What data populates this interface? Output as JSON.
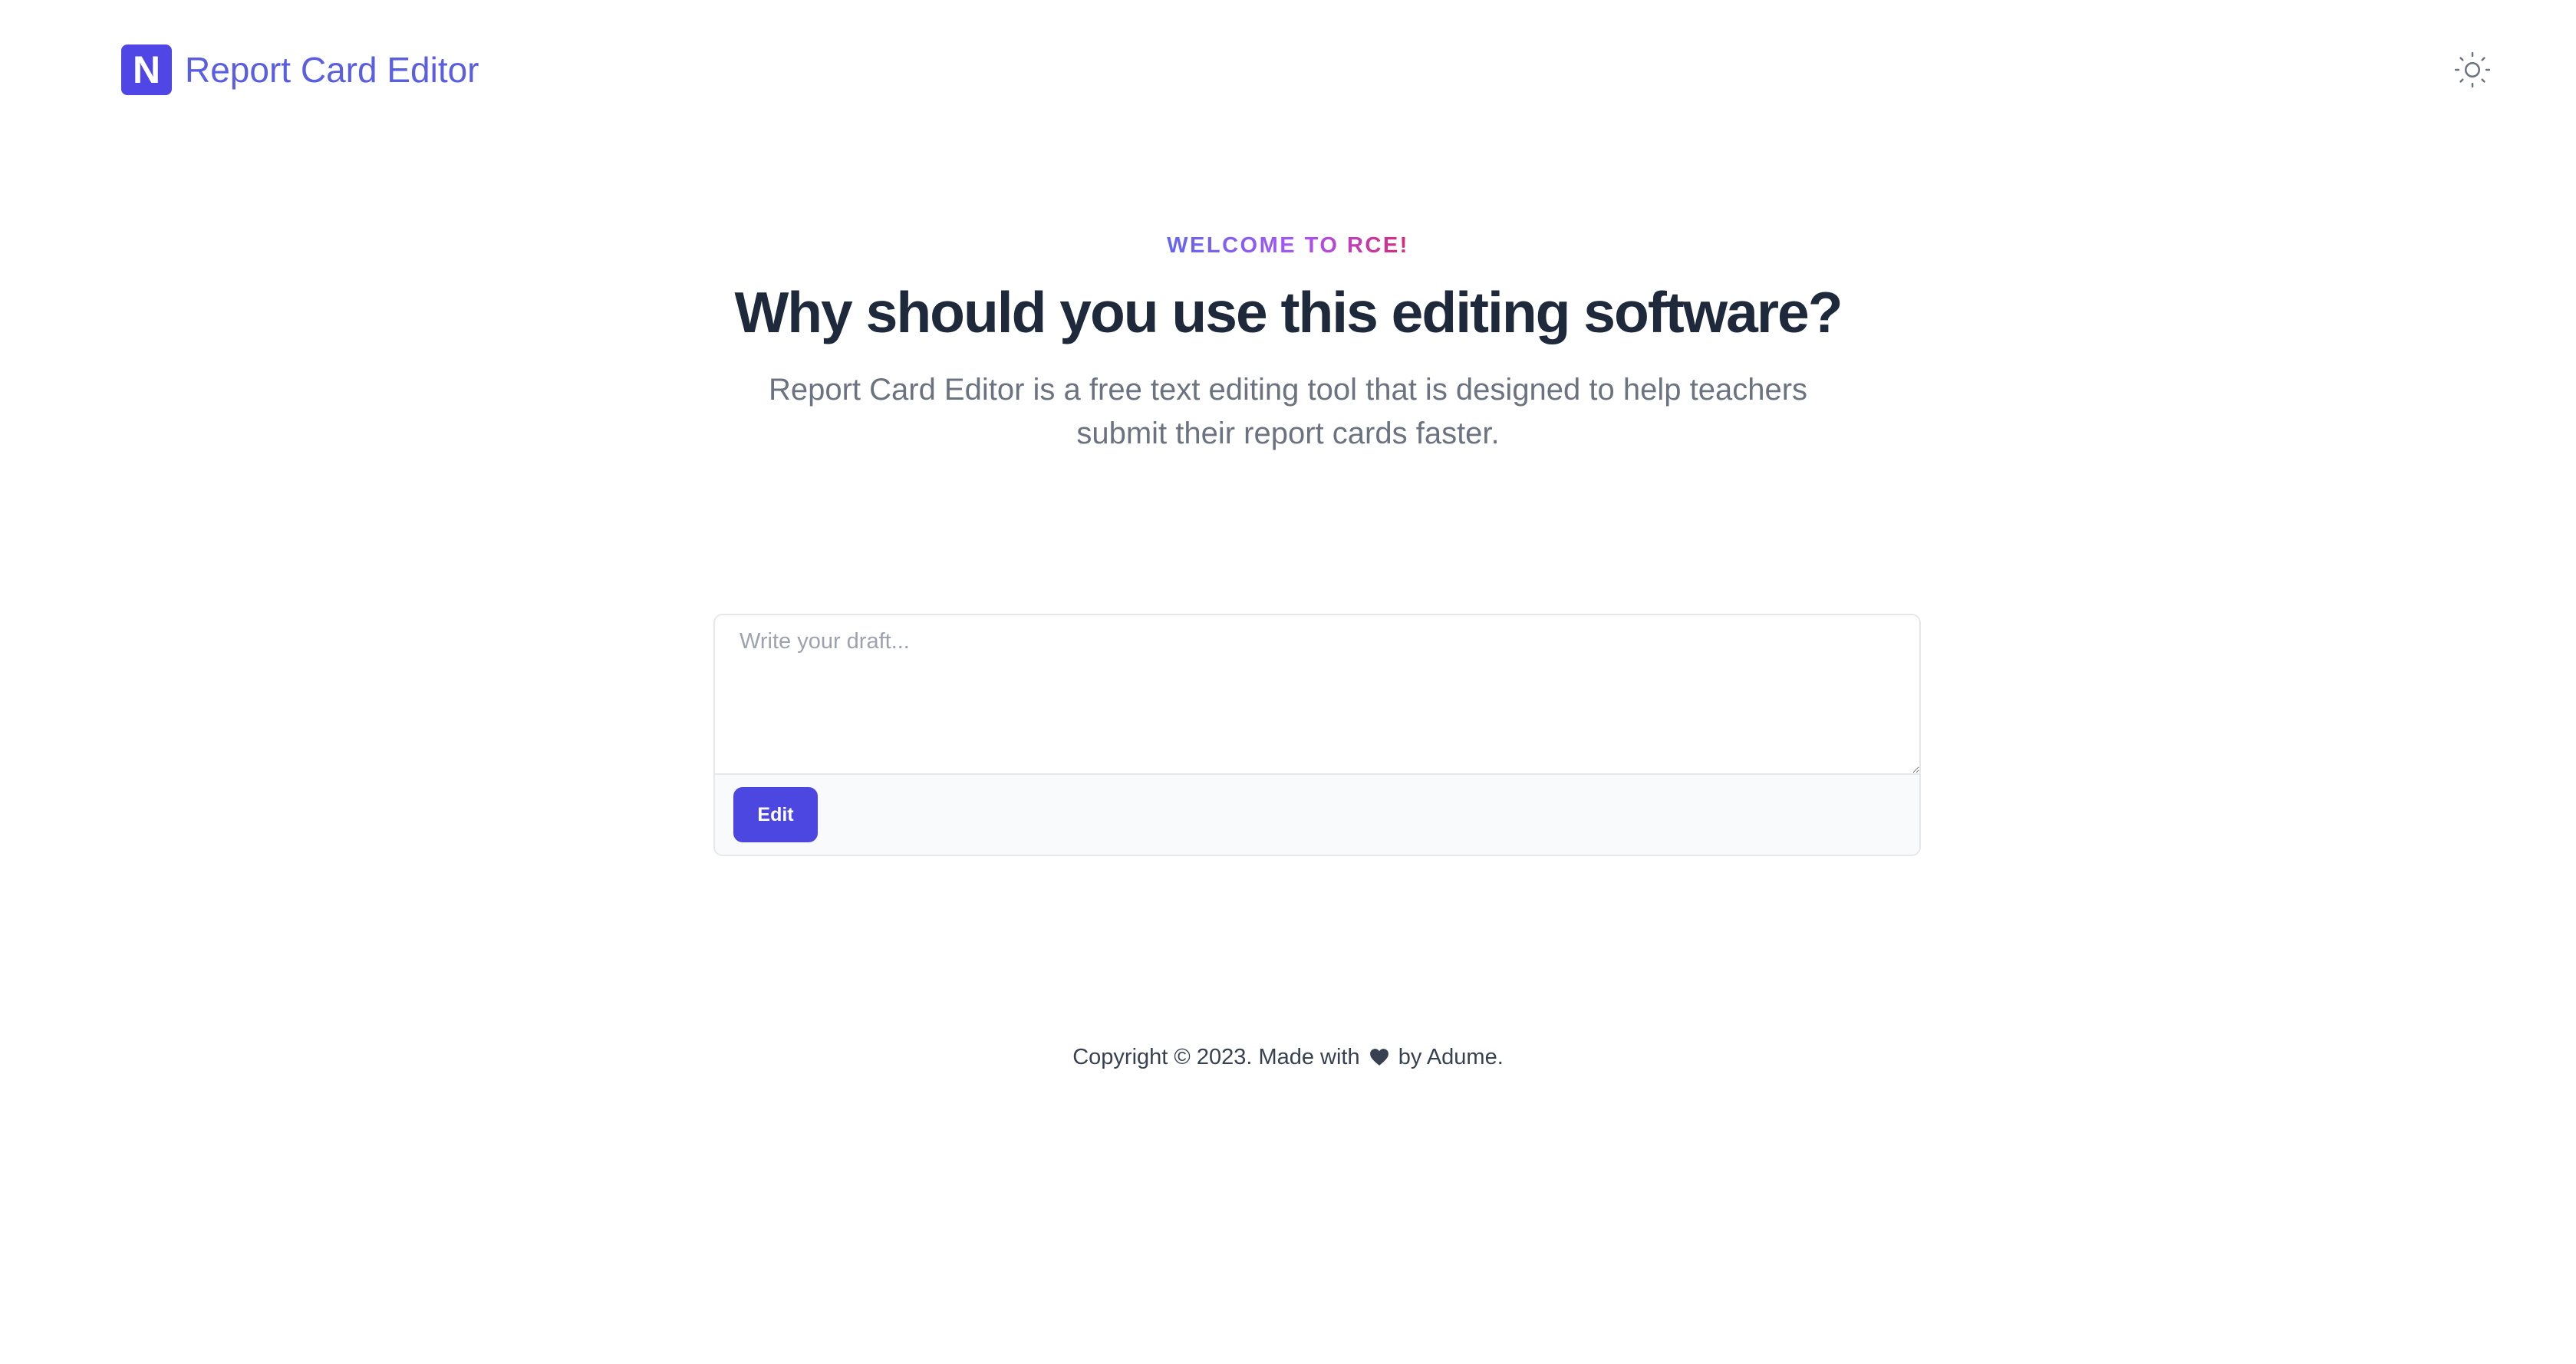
{
  "header": {
    "logo_letter": "N",
    "title": "Report Card Editor",
    "theme_icon": "sun-icon"
  },
  "hero": {
    "eyebrow": "WELCOME TO RCE!",
    "headline": "Why should you use this editing software?",
    "subtext": "Report Card Editor is a free text editing tool that is designed to help teachers submit their report cards faster."
  },
  "editor": {
    "draft_value": "",
    "draft_placeholder": "Write your draft...",
    "edit_label": "Edit"
  },
  "footer": {
    "copyright_prefix": "Copyright © 2023. Made with",
    "heart_icon": "heart-icon",
    "copyright_suffix": "by Adume."
  },
  "colors": {
    "brand": "#4f46e5",
    "logo_text": "#5a5ee0",
    "headline": "#1e293b",
    "muted_text": "#6b7280",
    "eyebrow_gradient": [
      "#6366f1",
      "#a855f7",
      "#db2777"
    ]
  }
}
